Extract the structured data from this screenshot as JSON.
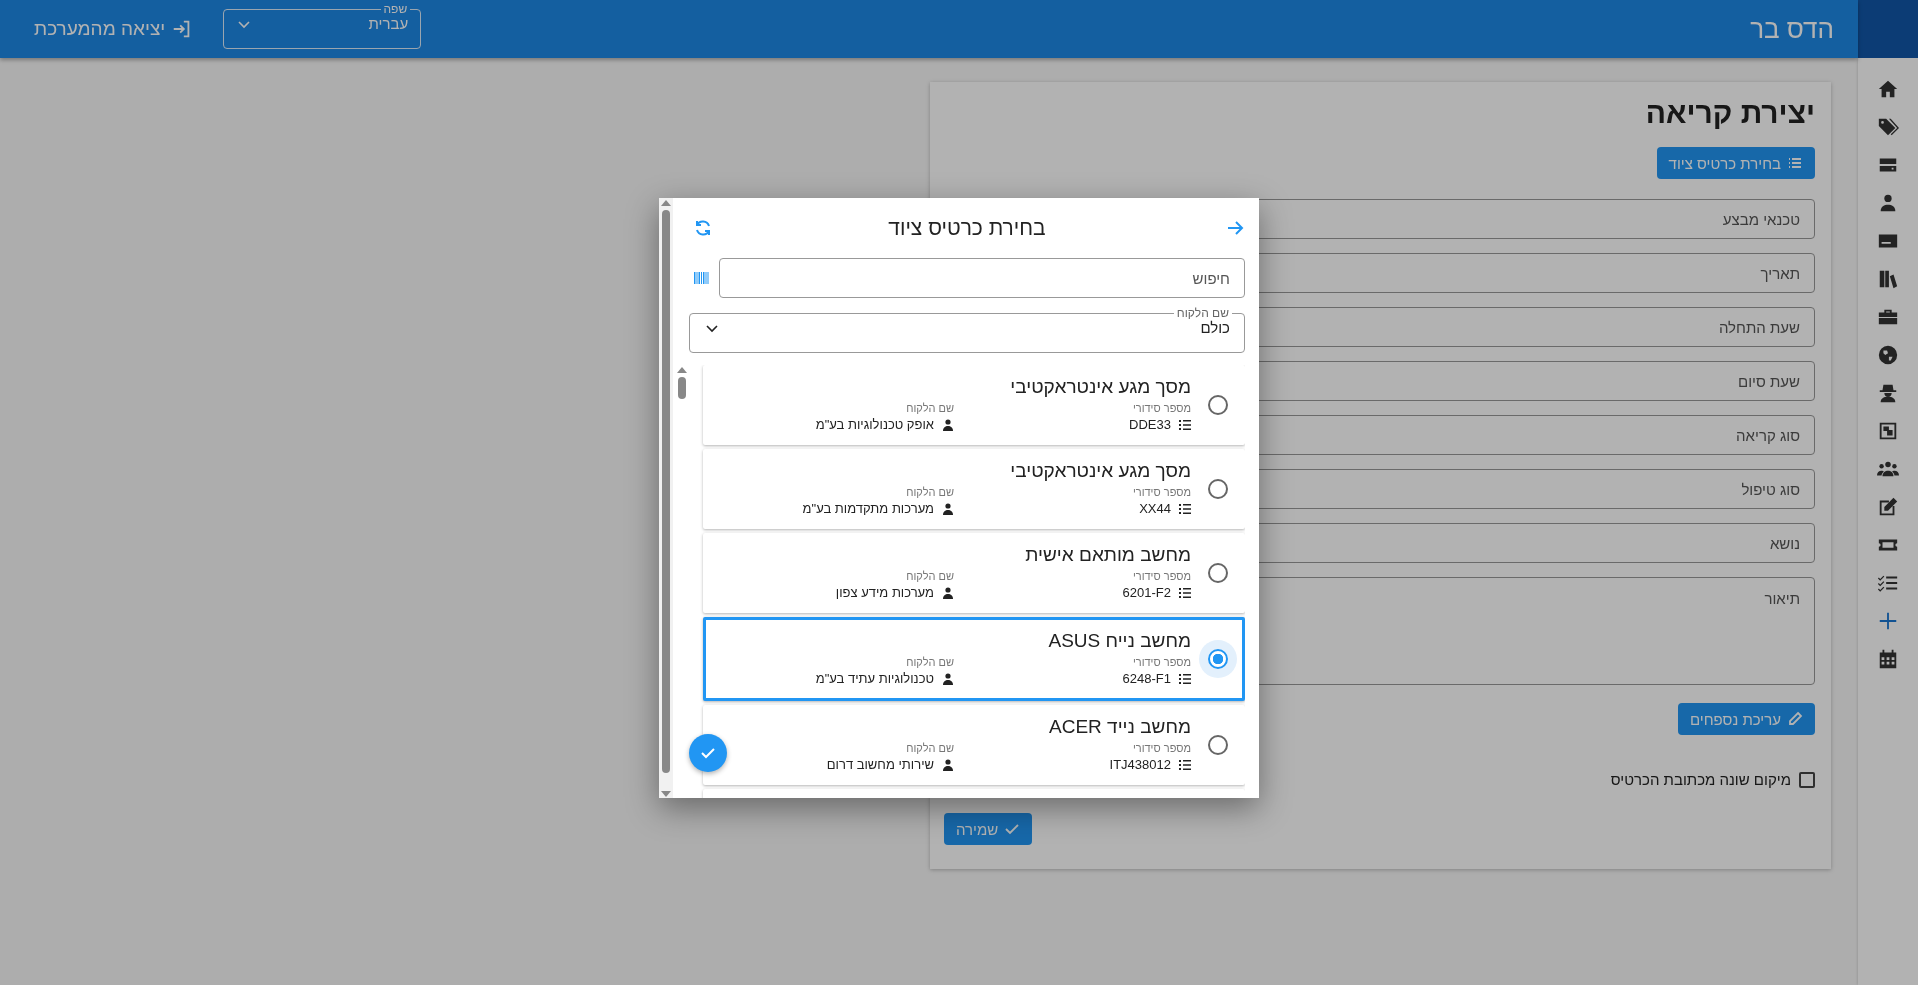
{
  "header": {
    "user_name": "הדס בר",
    "language": {
      "label": "שפה",
      "value": "עברית"
    },
    "logout": "יציאה מהמערכת"
  },
  "sidebar": {
    "items": [
      {
        "selected": false
      },
      {
        "selected": false
      },
      {
        "selected": false
      },
      {
        "selected": false
      },
      {
        "selected": false
      },
      {
        "selected": false
      },
      {
        "selected": false
      },
      {
        "selected": false
      },
      {
        "selected": false
      },
      {
        "selected": false
      },
      {
        "selected": false
      },
      {
        "selected": false
      },
      {
        "selected": false
      },
      {
        "selected": false
      },
      {
        "selected": true
      },
      {
        "selected": false
      }
    ]
  },
  "form": {
    "title": "יצירת קריאה",
    "equipment_button": "בחירת כרטיס ציוד",
    "fields": [
      {
        "placeholder": "טכנאי מבצע"
      },
      {
        "placeholder": "תאריך"
      },
      {
        "placeholder": "שעת התחלה"
      },
      {
        "placeholder": "שעת סיום"
      },
      {
        "placeholder": "סוג קריאה"
      },
      {
        "placeholder": "סוג טיפול"
      },
      {
        "placeholder": "נושא"
      }
    ],
    "description": {
      "placeholder": "תיאור"
    },
    "extras_button": "עריכת נספחים",
    "different_location": {
      "label": "מיקום שונה מכתובת הכרטיס",
      "checked": false
    },
    "save_button": "שמירה"
  },
  "dialog": {
    "title": "בחירת כרטיס ציוד",
    "search": {
      "placeholder": "חיפוש"
    },
    "customer_filter": {
      "label": "שם הלקוח",
      "value": "כולם"
    },
    "cards": [
      {
        "name": "מסך מגע אינטראקטיבי",
        "serial_label": "מספר סידורי",
        "serial": "DDE33",
        "customer_label": "שם הלקוח",
        "customer": "אופק טכנולוגיות בע\"מ",
        "selected": false
      },
      {
        "name": "מסך מגע אינטראקטיבי",
        "serial_label": "מספר סידורי",
        "serial": "XX44",
        "customer_label": "שם הלקוח",
        "customer": "מערכות מתקדמות בע\"מ",
        "selected": false
      },
      {
        "name": "מחשב מותאם אישית",
        "serial_label": "מספר סידורי",
        "serial": "6201-F2",
        "customer_label": "שם הלקוח",
        "customer": "מערכות מידע צפון",
        "selected": false
      },
      {
        "name": "מחשב נייח ASUS",
        "serial_label": "מספר סידורי",
        "serial": "6248-F1",
        "customer_label": "שם הלקוח",
        "customer": "טכנולוגיות עתיד בע\"מ",
        "selected": true
      },
      {
        "name": "מחשב נייד ACER",
        "serial_label": "מספר סידורי",
        "serial": "ITJ438012",
        "customer_label": "שם הלקוח",
        "customer": "שירותי מחשוב דרום",
        "selected": false
      }
    ]
  }
}
